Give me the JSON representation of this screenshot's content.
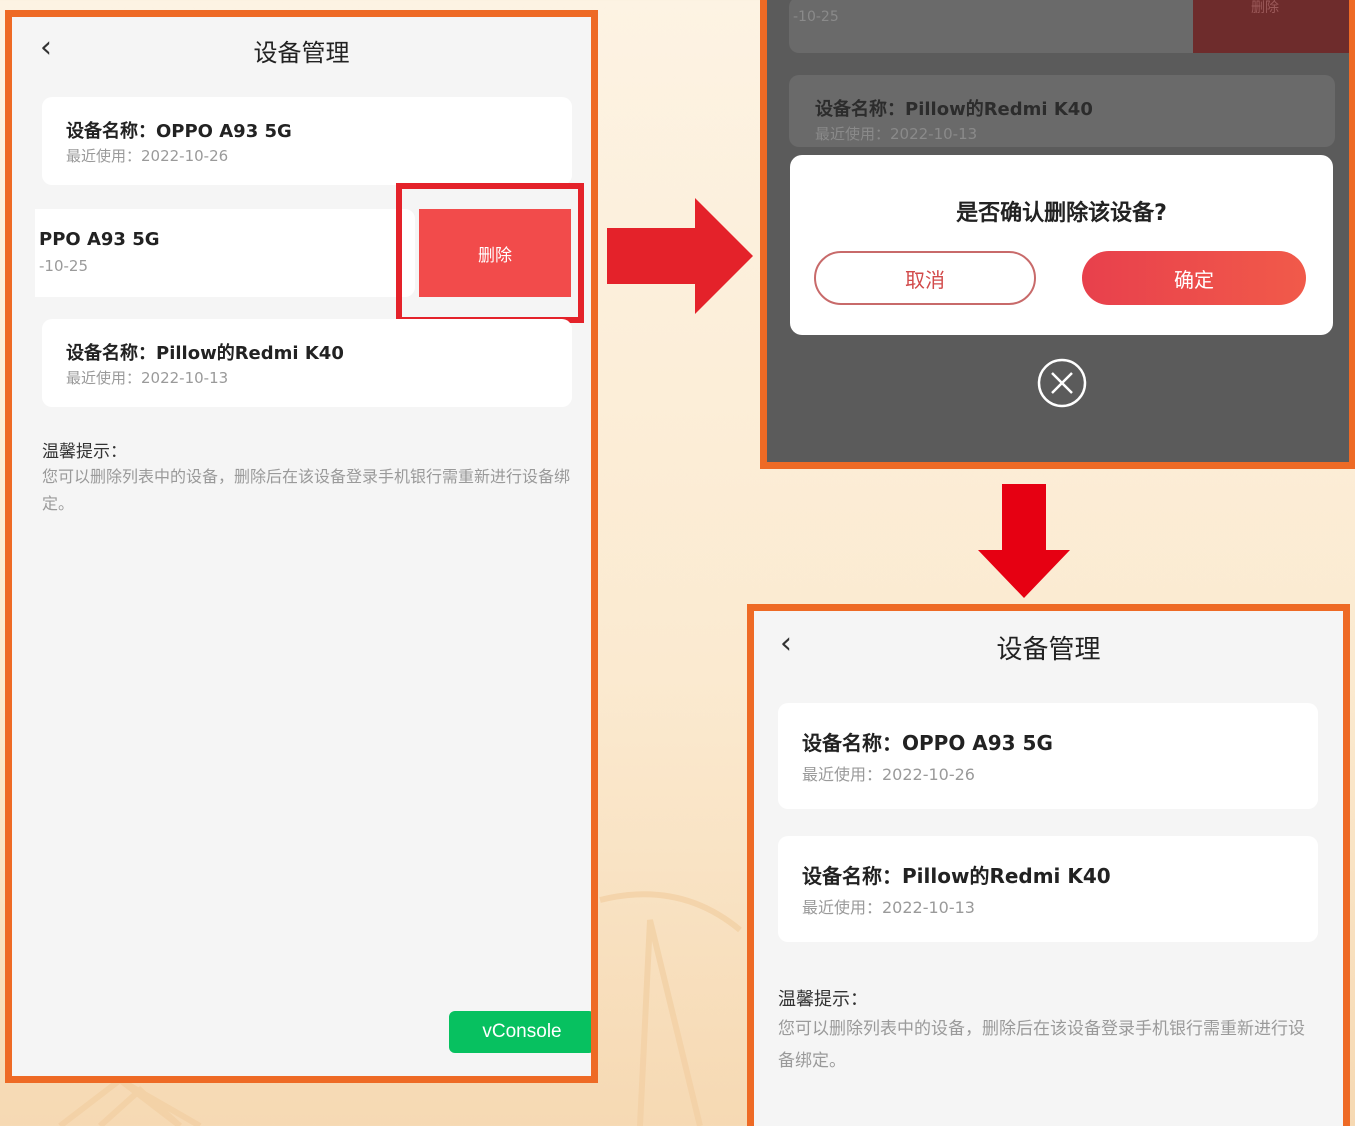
{
  "screen1": {
    "title": "设备管理",
    "back_icon": "chevron-left-icon",
    "devices": [
      {
        "name": "设备名称：OPPO A93 5G",
        "last_used": "最近使用：2022-10-26"
      },
      {
        "name": "PPO A93 5G",
        "last_used": "-10-25"
      },
      {
        "name": "设备名称：Pillow的Redmi K40",
        "last_used": "最近使用：2022-10-13"
      }
    ],
    "delete_label": "删除",
    "tips_title": "温馨提示：",
    "tips_text": "您可以删除列表中的设备，删除后在该设备登录手机银行需重新进行设备绑定。",
    "vconsole_label": "vConsole"
  },
  "screen2": {
    "bg_used_partial": "-10-25",
    "bg_delete_label": "删除",
    "bg_device_name": "设备名称：Pillow的Redmi K40",
    "bg_device_used": "最近使用：2022-10-13",
    "dialog_question": "是否确认删除该设备?",
    "cancel_label": "取消",
    "confirm_label": "确定",
    "close_icon": "close-circle-icon"
  },
  "screen3": {
    "title": "设备管理",
    "back_icon": "chevron-left-icon",
    "devices": [
      {
        "name": "设备名称：OPPO A93 5G",
        "last_used": "最近使用：2022-10-26"
      },
      {
        "name": "设备名称：Pillow的Redmi K40",
        "last_used": "最近使用：2022-10-13"
      }
    ],
    "tips_title": "温馨提示：",
    "tips_text": "您可以删除列表中的设备，删除后在该设备登录手机银行需重新进行设备绑定。"
  },
  "colors": {
    "frame": "#ee6a25",
    "delete_red": "#f24b4b",
    "arrow_red": "#e4222a",
    "vconsole_green": "#07c160"
  }
}
